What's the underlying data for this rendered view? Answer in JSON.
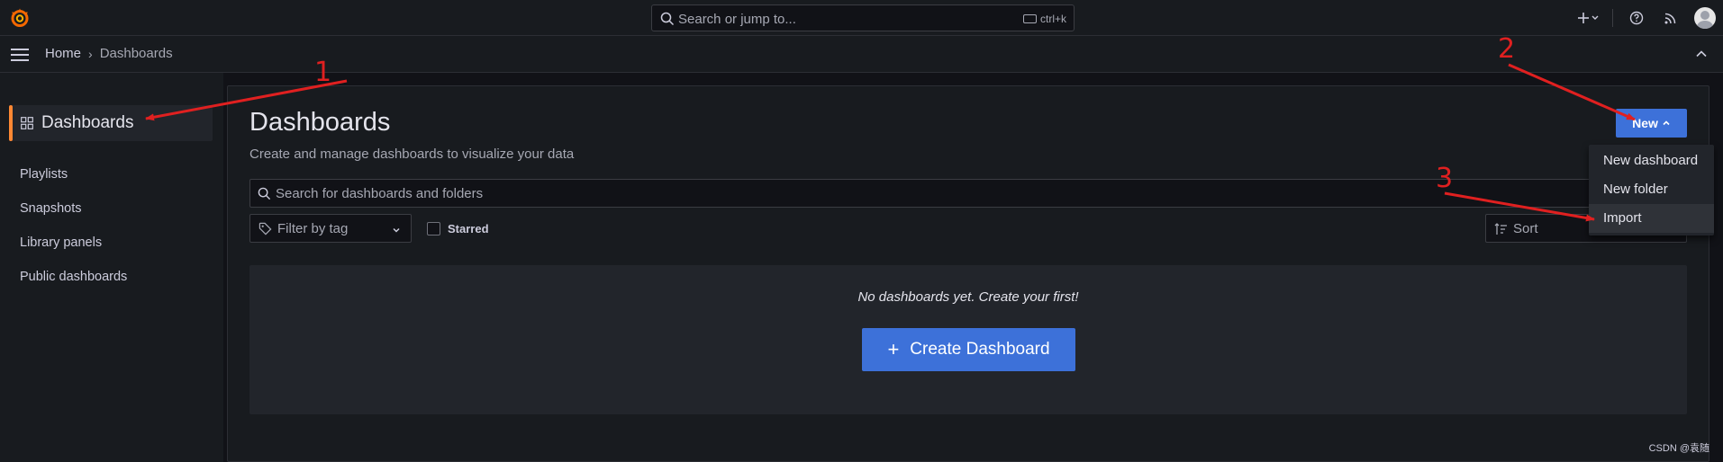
{
  "topbar": {
    "search_placeholder": "Search or jump to...",
    "shortcut": "ctrl+k"
  },
  "breadcrumb": {
    "home": "Home",
    "current": "Dashboards"
  },
  "sidebar": {
    "active": "Dashboards",
    "items": [
      "Playlists",
      "Snapshots",
      "Library panels",
      "Public dashboards"
    ]
  },
  "main": {
    "title": "Dashboards",
    "subtitle": "Create and manage dashboards to visualize your data",
    "new_button": "New",
    "search_placeholder": "Search for dashboards and folders",
    "filter_placeholder": "Filter by tag",
    "starred_label": "Starred",
    "sort_placeholder": "Sort",
    "empty_message": "No dashboards yet. Create your first!",
    "create_button": "Create Dashboard"
  },
  "new_menu": {
    "items": [
      "New dashboard",
      "New folder",
      "Import"
    ],
    "highlighted": "Import"
  },
  "annotations": {
    "numbers": [
      "1",
      "2",
      "3"
    ]
  },
  "watermark": "CSDN @袁随",
  "colors": {
    "accent_orange": "#ff8833",
    "primary_blue": "#3d71d9",
    "annotation_red": "#e02020"
  }
}
